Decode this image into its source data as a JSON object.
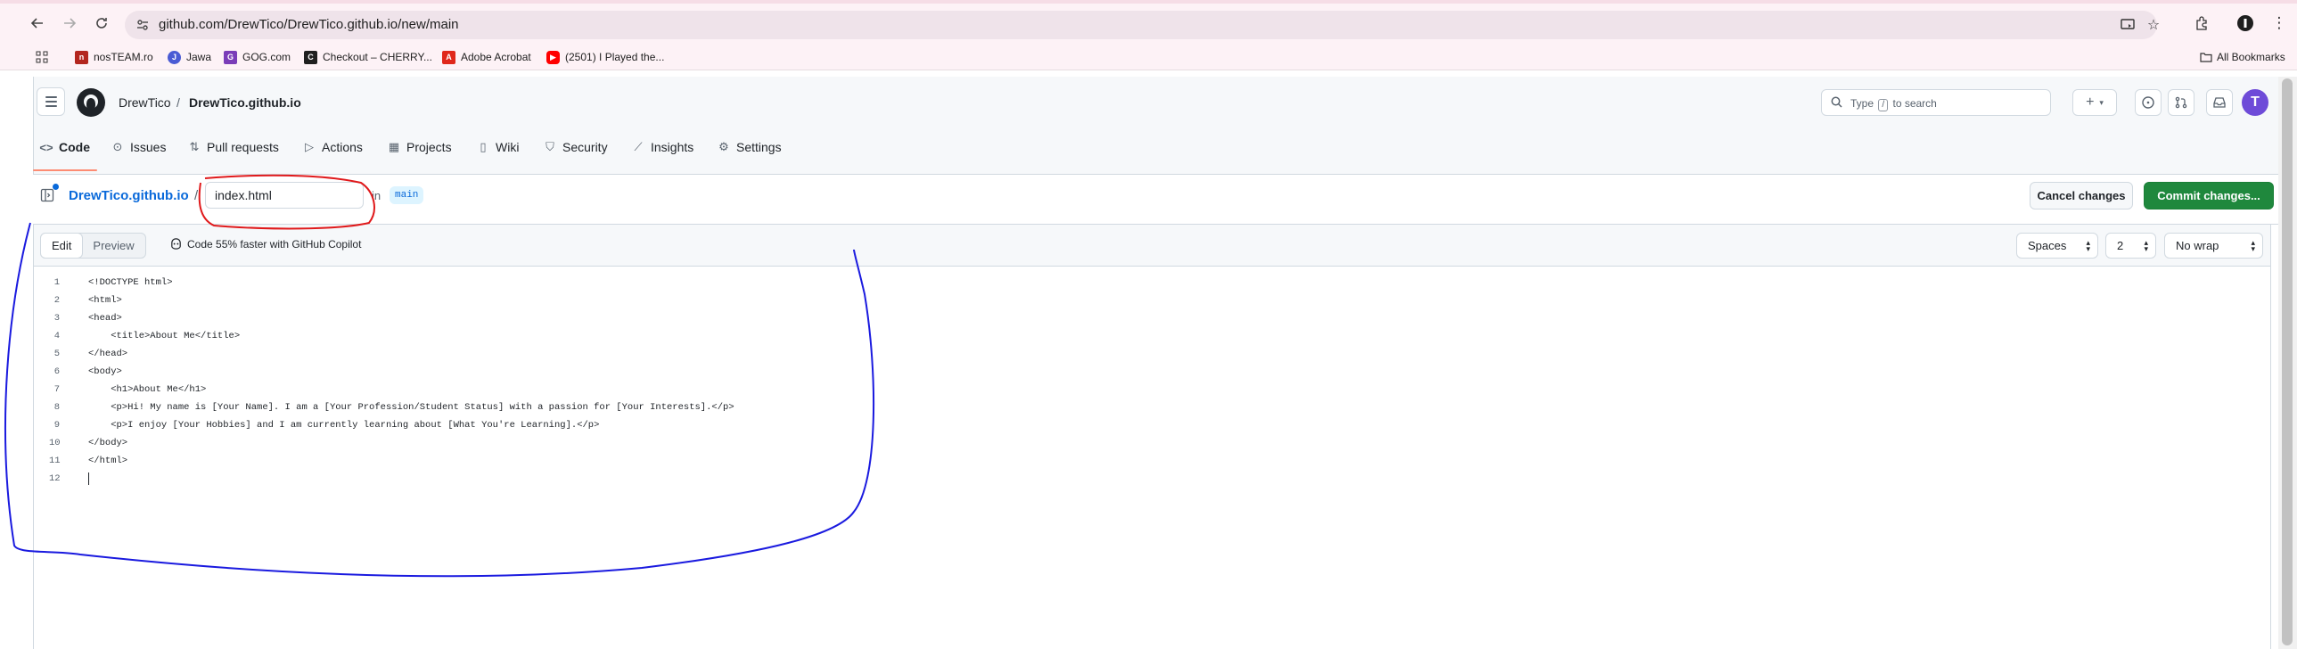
{
  "browser": {
    "url": "github.com/DrewTico/DrewTico.github.io/new/main",
    "bookmarks": [
      {
        "label": "nosTEAM.ro",
        "color": "#b3261e"
      },
      {
        "label": "Jawa",
        "color": "#4a5bd4"
      },
      {
        "label": "GOG.com",
        "color": "#7a3db8"
      },
      {
        "label": "Checkout – CHERRY...",
        "color": "#1f1f1f"
      },
      {
        "label": "Adobe Acrobat",
        "color": "#e0281b"
      },
      {
        "label": "(2501) I Played the...",
        "color": "#ff0000"
      }
    ],
    "all_bookmarks": "All Bookmarks"
  },
  "header": {
    "owner": "DrewTico",
    "separator": "/",
    "repo": "DrewTico.github.io",
    "search_prefix": "Type",
    "search_key": "/",
    "search_suffix": "to search",
    "avatar_letter": "T"
  },
  "tabs": [
    {
      "label": "Code",
      "icon": "code-icon"
    },
    {
      "label": "Issues",
      "icon": "issue-icon"
    },
    {
      "label": "Pull requests",
      "icon": "pull-request-icon"
    },
    {
      "label": "Actions",
      "icon": "play-icon"
    },
    {
      "label": "Projects",
      "icon": "table-icon"
    },
    {
      "label": "Wiki",
      "icon": "book-icon"
    },
    {
      "label": "Security",
      "icon": "shield-icon"
    },
    {
      "label": "Insights",
      "icon": "graph-icon"
    },
    {
      "label": "Settings",
      "icon": "gear-icon"
    }
  ],
  "path": {
    "repo_link": "DrewTico.github.io",
    "slash": "/",
    "filename": "index.html",
    "in_label": "in",
    "branch": "main"
  },
  "actions": {
    "cancel": "Cancel changes",
    "commit": "Commit changes..."
  },
  "editor": {
    "edit": "Edit",
    "preview": "Preview",
    "copilot": "Code 55% faster with GitHub Copilot",
    "indent_mode": "Spaces",
    "indent_size": "2",
    "wrap_mode": "No wrap",
    "lines": [
      "<!DOCTYPE html>",
      "<html>",
      "<head>",
      "    <title>About Me</title>",
      "</head>",
      "<body>",
      "    <h1>About Me</h1>",
      "    <p>Hi! My name is [Your Name]. I am a [Your Profession/Student Status] with a passion for [Your Interests].</p>",
      "    <p>I enjoy [Your Hobbies] and I am currently learning about [What You're Learning].</p>",
      "</body>",
      "</html>",
      ""
    ]
  },
  "colors": {
    "accent_blue": "#0969da",
    "commit_green": "#1f883d",
    "annotation_red": "#e0191b",
    "annotation_blue": "#1a1adf"
  }
}
